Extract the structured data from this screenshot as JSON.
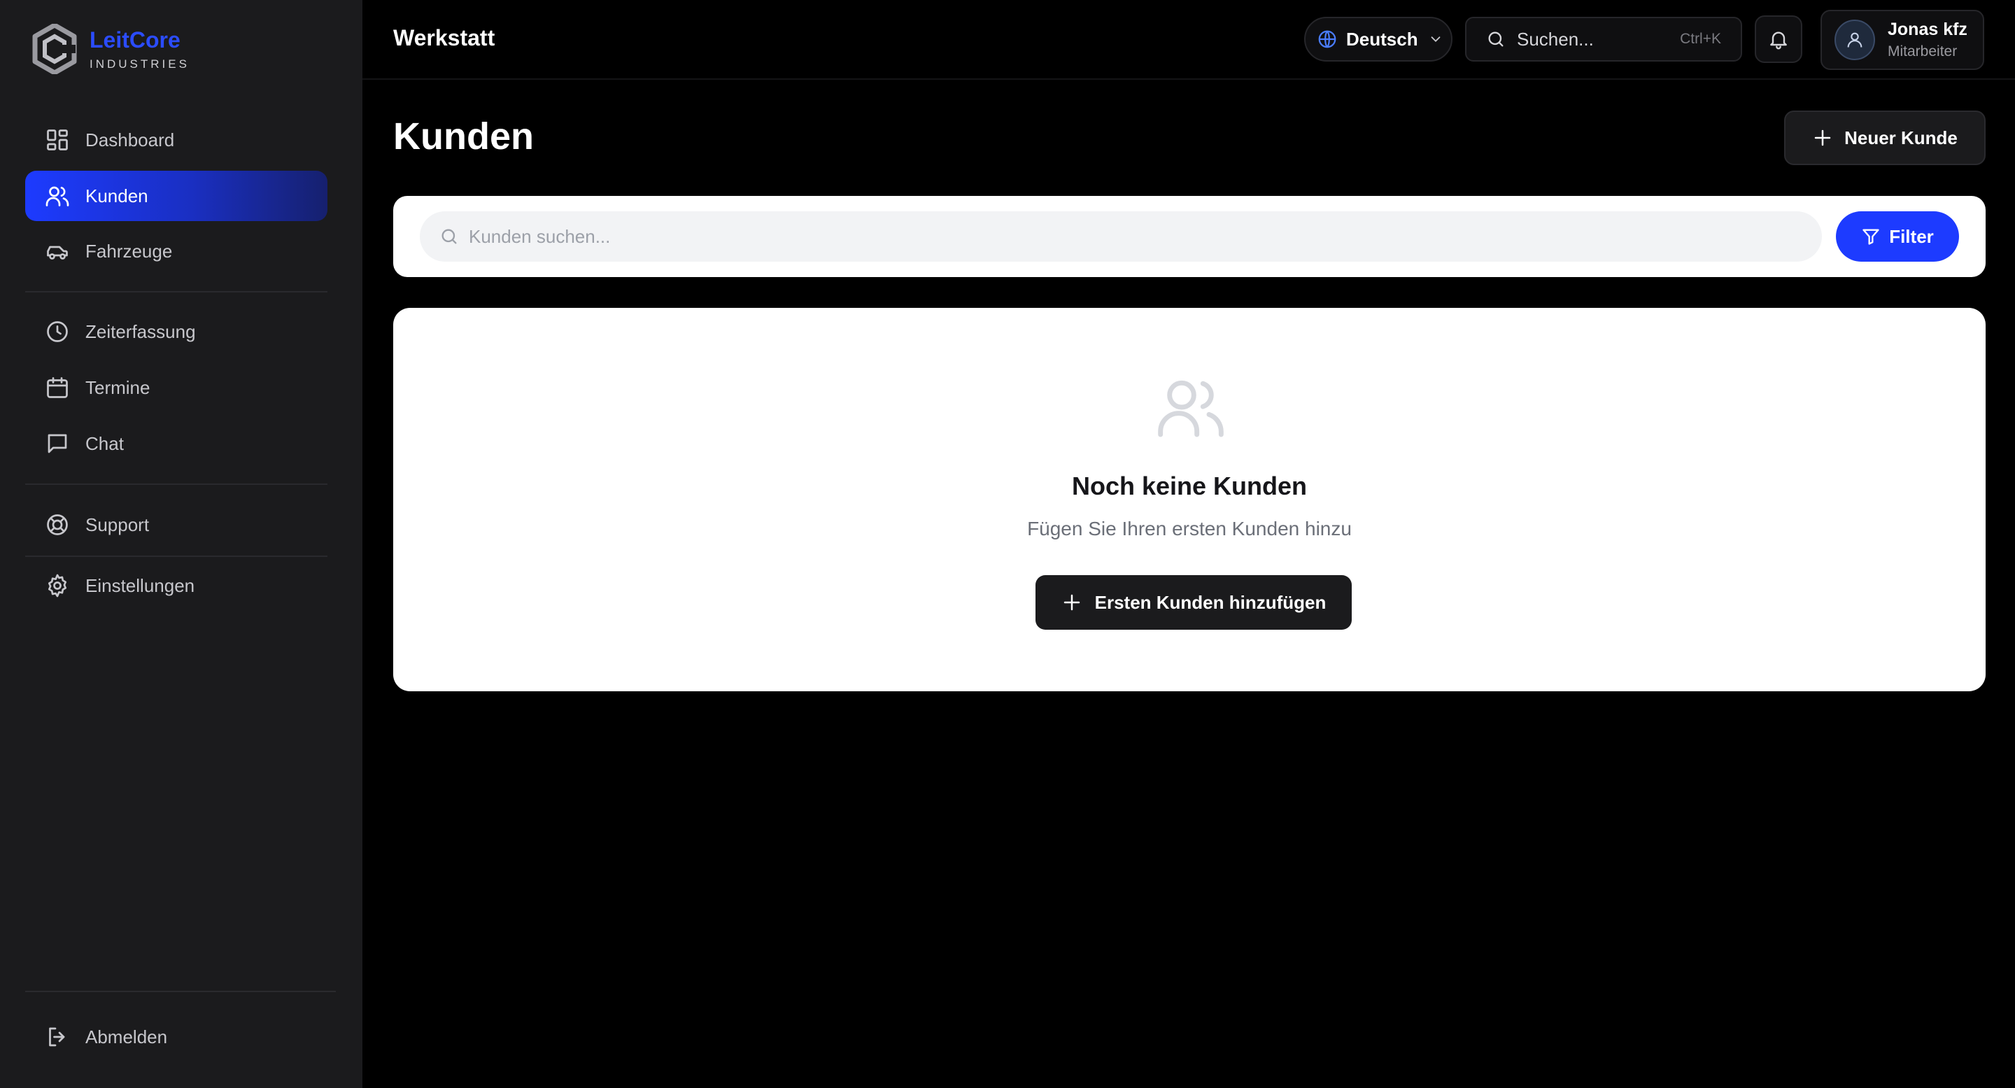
{
  "brand": {
    "name": "LeitCore",
    "subtitle": "INDUSTRIES"
  },
  "sidebar": {
    "items": [
      {
        "label": "Dashboard",
        "icon": "dashboard-icon",
        "active": false
      },
      {
        "label": "Kunden",
        "icon": "users-icon",
        "active": true
      },
      {
        "label": "Fahrzeuge",
        "icon": "car-icon",
        "active": false
      },
      {
        "label": "Zeiterfassung",
        "icon": "clock-icon",
        "active": false
      },
      {
        "label": "Termine",
        "icon": "calendar-icon",
        "active": false
      },
      {
        "label": "Chat",
        "icon": "chat-icon",
        "active": false
      },
      {
        "label": "Support",
        "icon": "lifebuoy-icon",
        "active": false
      },
      {
        "label": "Einstellungen",
        "icon": "gear-icon",
        "active": false
      }
    ],
    "logout_label": "Abmelden"
  },
  "header": {
    "workspace": "Werkstatt",
    "language": "Deutsch",
    "search_placeholder": "Suchen...",
    "search_shortcut": "Ctrl+K",
    "user": {
      "name": "Jonas kfz",
      "role": "Mitarbeiter"
    }
  },
  "page": {
    "title": "Kunden",
    "new_button": "Neuer Kunde",
    "search_placeholder": "Kunden suchen...",
    "filter_label": "Filter"
  },
  "empty_state": {
    "title": "Noch keine Kunden",
    "subtitle": "Fügen Sie Ihren ersten Kunden hinzu",
    "button": "Ersten Kunden hinzufügen"
  },
  "colors": {
    "accent": "#1d3bff",
    "sidebar_bg": "#1b1b1d",
    "main_bg": "#000000",
    "card_bg": "#ffffff"
  }
}
